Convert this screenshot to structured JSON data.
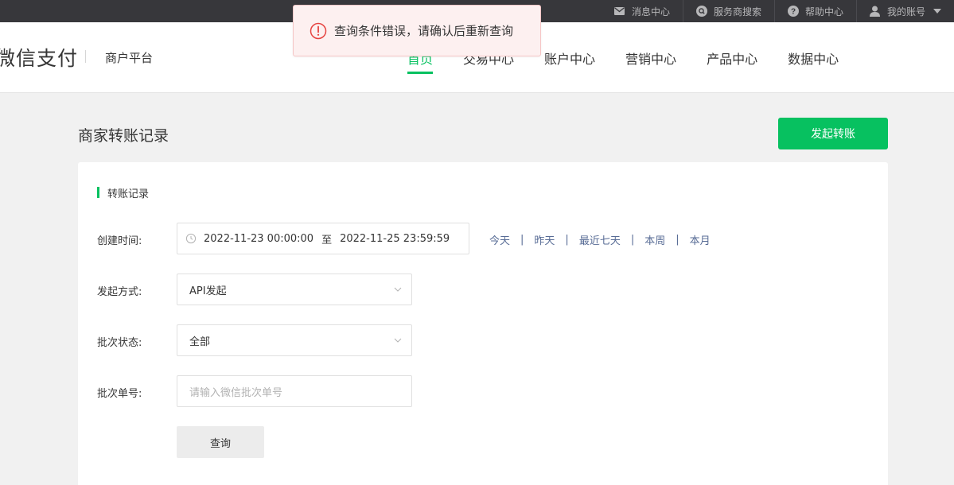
{
  "topbar": {
    "links": [
      {
        "label": "消息中心",
        "icon": "mail-icon"
      },
      {
        "label": "服务商搜索",
        "icon": "search-icon"
      },
      {
        "label": "帮助中心",
        "icon": "help-icon"
      },
      {
        "label": "我的账号",
        "icon": "user-icon"
      }
    ]
  },
  "header": {
    "brand": "微信支付",
    "platform": "商户平台",
    "nav": [
      {
        "label": "首页",
        "active": true
      },
      {
        "label": "交易中心"
      },
      {
        "label": "账户中心"
      },
      {
        "label": "营销中心"
      },
      {
        "label": "产品中心"
      },
      {
        "label": "数据中心"
      }
    ]
  },
  "toast": {
    "message": "查询条件错误，请确认后重新查询",
    "icon": "error-circle-icon"
  },
  "page": {
    "title": "商家转账记录",
    "primary_button": "发起转账",
    "section_title": "转账记录"
  },
  "form": {
    "created_time": {
      "label": "创建时间:",
      "start": "2022-11-23 00:00:00",
      "separator": "至",
      "end": "2022-11-25 23:59:59"
    },
    "quick_ranges": [
      "今天",
      "昨天",
      "最近七天",
      "本周",
      "本月"
    ],
    "quick_separator": "|",
    "initiation_method": {
      "label": "发起方式:",
      "value": "API发起"
    },
    "batch_status": {
      "label": "批次状态:",
      "value": "全部"
    },
    "batch_number": {
      "label": "批次单号:",
      "placeholder": "请输入微信批次单号"
    },
    "query_button": "查询"
  },
  "colors": {
    "accent": "#07c160",
    "link": "#576b95",
    "topbar": "#37373b",
    "error": "#e64340"
  }
}
